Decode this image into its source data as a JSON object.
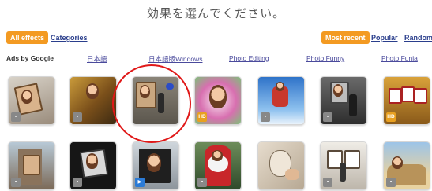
{
  "header": {
    "title": "効果を選んでください。"
  },
  "filters": {
    "all_effects": "All effects",
    "categories": "Categories",
    "most_recent": "Most recent",
    "popular": "Popular",
    "random": "Random"
  },
  "ads": {
    "label": "Ads by Google",
    "links": [
      "日本語",
      "日本語版Windows",
      "Photo Editing",
      "Photo Funny",
      "Photo Funia"
    ]
  },
  "colors": {
    "accent": "#f39a22",
    "link": "#2a3e8c",
    "annotation": "#e01818"
  },
  "row1": [
    {
      "badge": "photo"
    },
    {
      "badge": "photo"
    },
    {
      "badge": "none"
    },
    {
      "badge": "hd",
      "badge_text": "HD"
    },
    {
      "badge": "photo"
    },
    {
      "badge": "photo"
    },
    {
      "badge": "hd",
      "badge_text": "HD"
    }
  ],
  "row2": [
    {
      "badge": "photo"
    },
    {
      "badge": "photo"
    },
    {
      "badge": "video"
    },
    {
      "badge": "photo"
    },
    {
      "badge": "none"
    },
    {
      "badge": "photo"
    },
    {
      "badge": "photo"
    }
  ]
}
